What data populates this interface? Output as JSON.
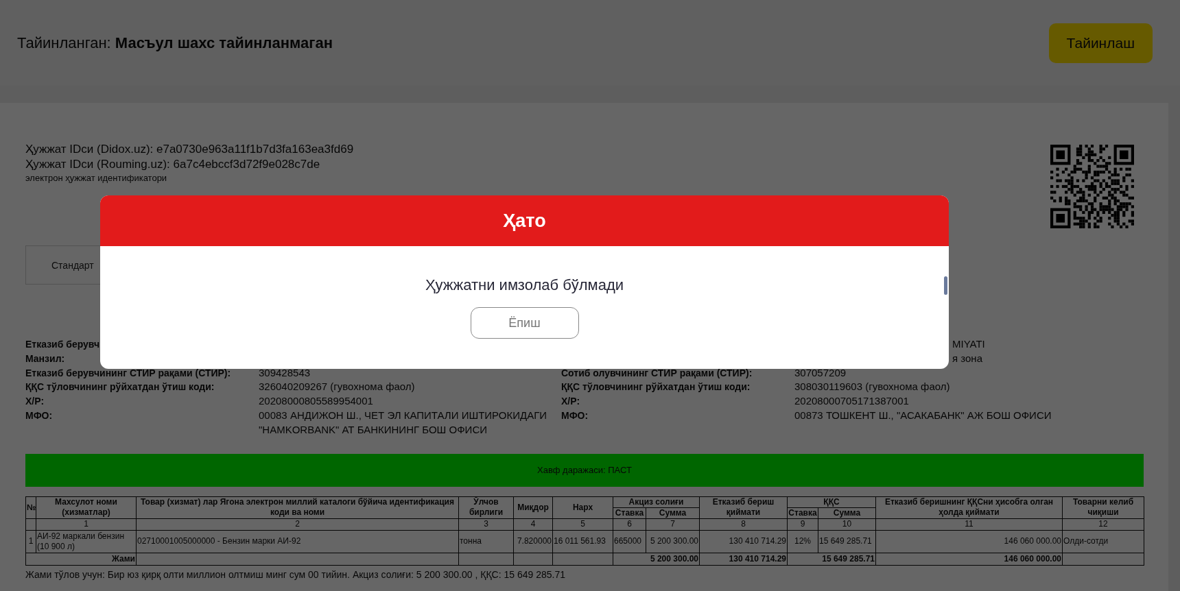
{
  "header": {
    "assignee": "Тайинланган: **Масъул шахс тайинланмаган**",
    "assign_button": "Тайинлаш"
  },
  "document": {
    "ids": [
      "Ҳужжат IDси (Didox.uz): e7a0730e963a11f1b7d3fa163ea3fd69",
      "Ҳужжат IDси (Rouming.uz): 6a7c4ebccf3d72f9e028c7de"
    ],
    "id_caption": "электрон ҳужжат идентификатори",
    "tabs": [
      {
        "label": "Стандарт"
      }
    ],
    "seller": [
      {
        "label": "Етказиб берувч"
      },
      {
        "label": "Манзил:"
      },
      {
        "label": "Етказиб берувчининг СТИР рақами  (СТИР):",
        "value": "309428543"
      },
      {
        "label": "ҚҚС тўловчининг рўйхатдан ўтиш коди:",
        "value": "326040209267 (гувохнома фаол)"
      },
      {
        "label": "Х/Р:",
        "value": "20208000805589954001"
      },
      {
        "label": "МФО:",
        "value": "00083 АНДИЖОН Ш., ЧЕТ ЭЛ КАПИТАЛИ ИШТИРОКИДАГИ \"HAMKORBANK\" АТ БАНКИНИНГ БОШ ОФИСИ"
      }
    ],
    "buyer": [
      {
        "value": "MIYATI"
      },
      {
        "value": "я зона"
      },
      {
        "label": "Сотиб олувчининг СТИР рақами (СТИР):",
        "value": "307057209"
      },
      {
        "label": "ҚҚС тўловчининг рўйхатдан ўтиш коди:",
        "value": "308030119603 (гувохнома фаол)"
      },
      {
        "label": "Х/Р:",
        "value": "20208000705171387001"
      },
      {
        "label": "МФО:",
        "value": "00873 ТОШКЕНТ Ш., \"АСАКАБАНК\" АЖ БОШ ОФИСИ"
      }
    ],
    "risk": "Хавф даражаси: ПАСТ",
    "table": {
      "columns": [
        {
          "label": "№"
        },
        {
          "label": "Махсулот номи (хизматлар)"
        },
        {
          "label": "Товар (хизмат) лар Ягона электрон миллий каталоги бўйича идентификация коди ва номи"
        },
        {
          "label": "Ўлчов бирлиги"
        },
        {
          "label": "Миқдор"
        },
        {
          "label": "Нарх"
        },
        {
          "label": "Акциз солиғи",
          "colspan": 2,
          "children": [
            {
              "label": "Ставка"
            },
            {
              "label": "Сумма"
            }
          ]
        },
        {
          "label": "Етказиб бериш қиймати"
        },
        {
          "label": "ҚҚС",
          "colspan": 2,
          "children": [
            {
              "label": "Ставка"
            },
            {
              "label": "Сумма"
            }
          ]
        },
        {
          "label": "Етказиб беришнинг ҚҚСни ҳисобга олган ҳолда қиймати"
        },
        {
          "label": "Товарни келиб чиқиши"
        }
      ],
      "column_numbers": [
        "1",
        "2",
        "3",
        "4",
        "5",
        "6",
        "7",
        "8",
        "9",
        "10",
        "11",
        "12"
      ],
      "rows": [
        [
          "1",
          "АИ-92 маркали бензин (10 900 л)",
          "02710001005000000 - Бензин марки АИ-92",
          "тонна",
          "7.820000",
          "16 011 561.93",
          "665000",
          "5 200 300.00",
          "130 410 714.29",
          "12%",
          "15 649 285.71",
          "146 060 000.00",
          "Олди-сотди"
        ]
      ],
      "total": {
        "label": "Жами",
        "excise_sum": "5 200 300.00",
        "supply_value": "130 410 714.29",
        "vat_sum": "15 649 285.71",
        "total_value": "146 060 000.00"
      }
    },
    "summary": "Жами тўлов учун: Бир юз қирқ олти миллион олтмиш минг сум 00 тийин.  Акциз солиғи: 5 200 300.00 ,  ҚҚС: 15 649 285.71"
  },
  "dialog": {
    "title": "Ҳато",
    "message": "Ҳужжатни имзолаб бўлмади",
    "button": "Ёпиш"
  }
}
